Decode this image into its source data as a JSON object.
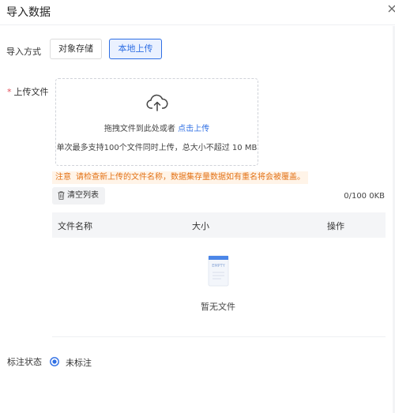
{
  "dialog": {
    "title": "导入数据"
  },
  "import_method": {
    "label": "导入方式",
    "options": [
      "对象存储",
      "本地上传"
    ],
    "selected": "本地上传"
  },
  "upload": {
    "label": "上传文件",
    "drag_text": "拖拽文件到此处或者",
    "click_text": "点击上传",
    "limit_text": "单次最多支持100个文件同时上传，总大小不超过 10 MB"
  },
  "notice": {
    "tag": "注意",
    "text": "请检查新上传的文件名称，数据集存量数据如有重名将会被覆盖。"
  },
  "file_list": {
    "clear_label": "清空列表",
    "size_summary": "0/100 0KB",
    "columns": [
      "文件名称",
      "大小",
      "操作"
    ],
    "empty_badge": "EMPTY",
    "empty_text": "暂无文件"
  },
  "annotation": {
    "label": "标注状态",
    "option": "未标注"
  },
  "colors": {
    "primary": "#2f6fe4",
    "warning": "#e37318",
    "required": "#e34d59"
  }
}
